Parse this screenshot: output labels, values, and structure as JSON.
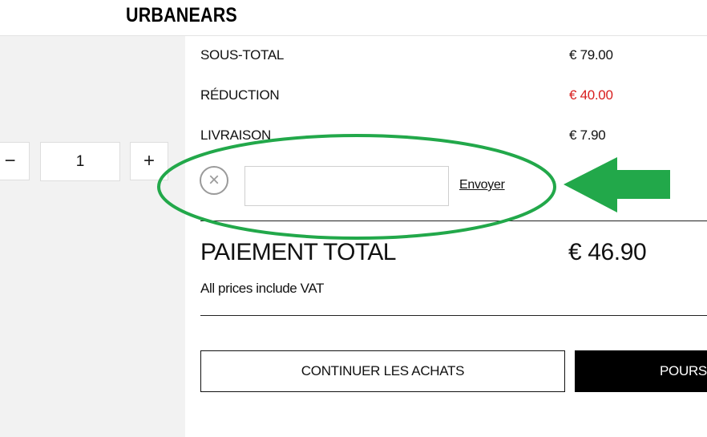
{
  "brand": {
    "logo_text": "URBANEARS"
  },
  "quantity": {
    "minus_symbol": "−",
    "value": "1",
    "plus_symbol": "+"
  },
  "summary": {
    "subtotal_label": "SOUS-TOTAL",
    "subtotal_value": "€ 79.00",
    "discount_label": "RÉDUCTION",
    "discount_value": "€ 40.00",
    "shipping_label": "LIVRAISON",
    "shipping_value": "€ 7.90"
  },
  "promo": {
    "clear_symbol": "×",
    "input_value": "",
    "input_placeholder": "",
    "submit_label": "Envoyer"
  },
  "total": {
    "label": "PAIEMENT TOTAL",
    "value": "€ 46.90",
    "vat_note": "All prices include VAT"
  },
  "actions": {
    "continue_label": "CONTINUER LES ACHATS",
    "checkout_label": "POURS"
  },
  "colors": {
    "discount": "#d81e1e",
    "annotation": "#22a84a",
    "left_panel_bg": "#f2f2f2"
  },
  "icons": {
    "clear": "close-circle-icon",
    "annotation_arrow": "arrow-left-icon",
    "annotation_ellipse": "highlight-ellipse"
  }
}
